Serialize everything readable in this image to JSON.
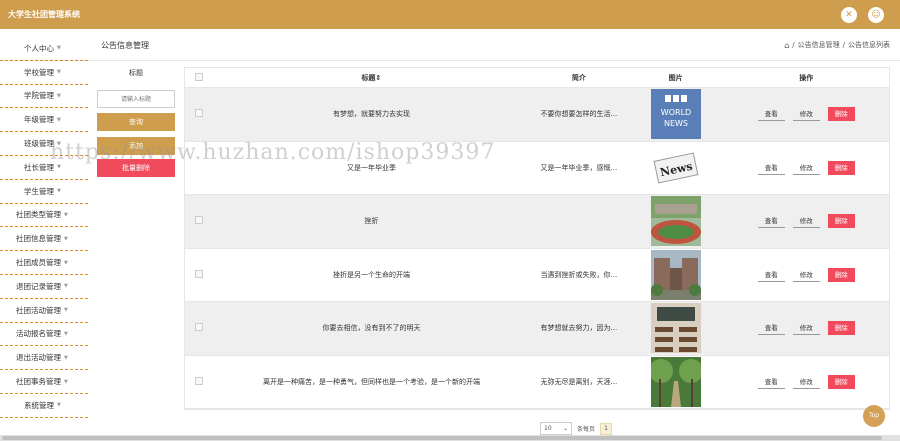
{
  "app": {
    "title": "大学生社团管理系统"
  },
  "header": {
    "page_title": "公告信息管理",
    "breadcrumb": [
      "公告信息管理",
      "公告信息列表"
    ],
    "sep": "/"
  },
  "sidebar": {
    "items": [
      {
        "label": "个人中心"
      },
      {
        "label": "学校管理"
      },
      {
        "label": "学院管理"
      },
      {
        "label": "年级管理"
      },
      {
        "label": "班级管理"
      },
      {
        "label": "社长管理"
      },
      {
        "label": "学生管理"
      },
      {
        "label": "社团类型管理"
      },
      {
        "label": "社团信息管理"
      },
      {
        "label": "社团成员管理"
      },
      {
        "label": "退团记录管理"
      },
      {
        "label": "社团活动管理"
      },
      {
        "label": "活动报名管理"
      },
      {
        "label": "退出活动管理"
      },
      {
        "label": "社团事务管理"
      },
      {
        "label": "系统管理"
      }
    ]
  },
  "filter": {
    "label": "标题",
    "placeholder": "请输入标题",
    "query_label": "查询",
    "add_label": "添加",
    "batch_delete_label": "批量删除"
  },
  "table": {
    "headers": {
      "title": "标题⇕",
      "summary": "简介",
      "image": "图片",
      "ops": "操作"
    },
    "op_labels": {
      "view": "查看",
      "edit": "修改",
      "delete": "删除"
    },
    "rows": [
      {
        "title": "有梦想，就要努力去实现",
        "summary": "不要你想要怎样的生活...",
        "image": "bbc"
      },
      {
        "title": "又是一年毕业季",
        "summary": "又是一年毕业季，感慨...",
        "image": "news"
      },
      {
        "title": "挫折"
      },
      {
        "title": "挫折是另一个生命的开端",
        "summary": "当遇到挫折或失败，你...",
        "image": "campus"
      },
      {
        "title": "你要去相信，没有到不了的明天",
        "summary": "有梦想就去努力，因为...",
        "image": "classroom"
      },
      {
        "title": "离开是一种痛苦，是一种勇气，但同样也是一个考验，是一个新的开端",
        "summary": "无弥无尽是离别，天涯...",
        "image": "trees"
      }
    ]
  },
  "pager": {
    "page_size": "10",
    "per_page_label": "条每页",
    "current": "1"
  },
  "misc": {
    "top_label": "Top",
    "watermark": "https://www.huzhan.com/ishop39397"
  },
  "colors": {
    "brand": "#cf9d4e",
    "danger": "#f04a5c"
  }
}
